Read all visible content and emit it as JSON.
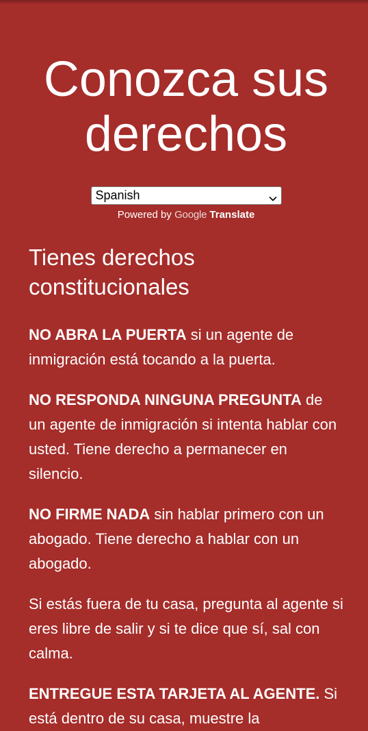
{
  "page": {
    "title": "Conozca sus derechos"
  },
  "translate": {
    "selected_language": "Spanish",
    "powered_prefix": "Powered by",
    "google_label": "Google",
    "translate_label": "Translate"
  },
  "section": {
    "heading": "Tienes derechos constitucionales"
  },
  "paragraphs": [
    {
      "bold": "NO ABRA LA PUERTA",
      "text": " si un agente de inmigración está tocando a la puerta."
    },
    {
      "bold": "NO RESPONDA NINGUNA PREGUNTA",
      "text": " de un agente de inmigración si intenta hablar con usted. Tiene derecho a permanecer en silencio."
    },
    {
      "bold": "NO FIRME NADA",
      "text": " sin hablar primero con un abogado. Tiene derecho a hablar con un abogado."
    },
    {
      "bold": "",
      "text": "Si estás fuera de tu casa, pregunta al agente si eres libre de salir y si te dice que sí, sal con calma."
    },
    {
      "bold": "ENTREGUE ESTA TARJETA AL AGENTE.",
      "text": " Si está dentro de su casa, muestre la"
    }
  ],
  "colors": {
    "background": "#a52d2a",
    "text": "#ffffff"
  },
  "icons": {
    "select_arrow": "chevron-down-icon"
  }
}
